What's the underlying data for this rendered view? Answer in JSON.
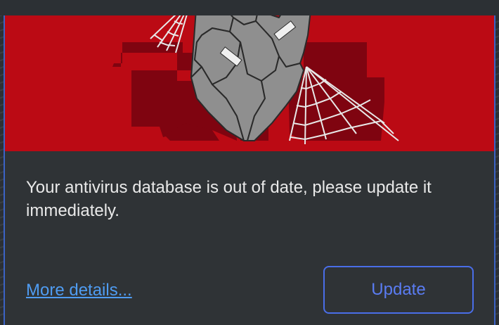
{
  "dialog": {
    "message": "Your antivirus database is out of date, please update it immediately.",
    "more_details_label": "More details...",
    "update_label": "Update"
  },
  "colors": {
    "banner_red": "#bb0a14",
    "dark_red": "#7f0410",
    "dialog_bg": "#2f3336",
    "text": "#e9e9e9",
    "link": "#4f9cf2",
    "button_border": "#4a6ee8"
  },
  "icons": {
    "banner_illustration": "broken-shield-with-cobwebs-icon"
  }
}
